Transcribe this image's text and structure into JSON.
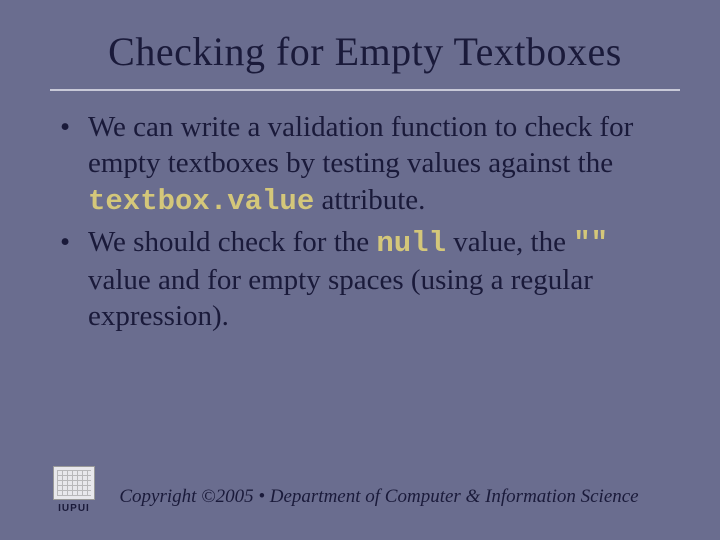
{
  "title": "Checking for Empty Textboxes",
  "bullets": {
    "b1": {
      "t1": "We can write a validation function to check for empty textboxes by testing values against the ",
      "c1": "textbox.value",
      "t2": " attribute."
    },
    "b2": {
      "t1": "We should check for the ",
      "c1": "null",
      "t2": " value, the ",
      "c2": "\"\"",
      "t3": " value and for empty spaces (using a regular expression)."
    }
  },
  "logo": {
    "text": "IUPUI"
  },
  "copyright": "Copyright ©2005 • Department of Computer & Information Science"
}
